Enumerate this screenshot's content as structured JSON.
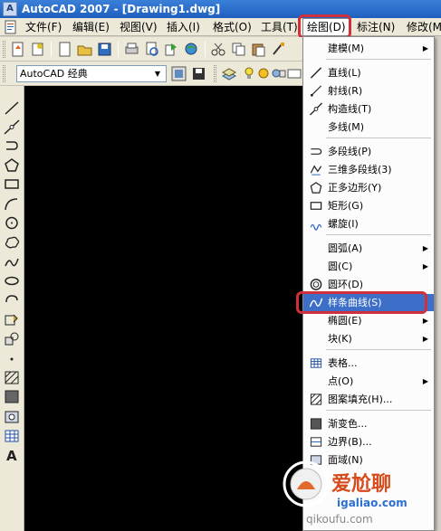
{
  "window": {
    "title": "AutoCAD 2007 - [Drawing1.dwg]"
  },
  "menubar": {
    "items": [
      {
        "label": "文件(F)"
      },
      {
        "label": "编辑(E)"
      },
      {
        "label": "视图(V)"
      },
      {
        "label": "插入(I)"
      },
      {
        "label": "格式(O)"
      },
      {
        "label": "工具(T)"
      },
      {
        "label": "绘图(D)",
        "active": true
      },
      {
        "label": "标注(N)"
      },
      {
        "label": "修改(M)"
      }
    ]
  },
  "toolbar": {
    "workspace": "AutoCAD 经典"
  },
  "draw_menu": {
    "items": [
      {
        "label": "建模(M)",
        "icon": "none",
        "submenu": true
      },
      {
        "label": "直线(L)",
        "icon": "line-icon",
        "submenu": false
      },
      {
        "label": "射线(R)",
        "icon": "ray-icon",
        "submenu": false
      },
      {
        "label": "构造线(T)",
        "icon": "construction-line-icon",
        "submenu": false
      },
      {
        "label": "多线(M)",
        "icon": "none",
        "submenu": false
      },
      {
        "label": "多段线(P)",
        "icon": "polyline-icon",
        "submenu": false
      },
      {
        "label": "三维多段线(3)",
        "icon": "3d-polyline-icon",
        "submenu": false
      },
      {
        "label": "正多边形(Y)",
        "icon": "polygon-icon",
        "submenu": false
      },
      {
        "label": "矩形(G)",
        "icon": "rectangle-icon",
        "submenu": false
      },
      {
        "label": "螺旋(I)",
        "icon": "helix-icon",
        "submenu": false
      },
      {
        "label": "圆弧(A)",
        "icon": "none",
        "submenu": true
      },
      {
        "label": "圆(C)",
        "icon": "none",
        "submenu": true
      },
      {
        "label": "圆环(D)",
        "icon": "donut-icon",
        "submenu": false
      },
      {
        "label": "样条曲线(S)",
        "icon": "spline-icon",
        "submenu": false,
        "highlighted": true
      },
      {
        "label": "椭圆(E)",
        "icon": "none",
        "submenu": true
      },
      {
        "label": "块(K)",
        "icon": "none",
        "submenu": true
      },
      {
        "label": "表格...",
        "icon": "table-icon",
        "submenu": false
      },
      {
        "label": "点(O)",
        "icon": "none",
        "submenu": true
      },
      {
        "label": "图案填充(H)...",
        "icon": "hatch-icon",
        "submenu": false
      },
      {
        "label": "渐变色...",
        "icon": "gradient-icon",
        "submenu": false
      },
      {
        "label": "边界(B)...",
        "icon": "boundary-icon",
        "submenu": false
      },
      {
        "label": "面域(N)",
        "icon": "region-icon",
        "submenu": false
      }
    ]
  },
  "watermark": {
    "text1": "爱尬聊",
    "text2": "igaliao.com",
    "text3": "qikoufu.com"
  },
  "colors": {
    "accent_highlight": "#3d6fc8",
    "annotation_red": "#d0303c",
    "canvas": "#000000"
  }
}
